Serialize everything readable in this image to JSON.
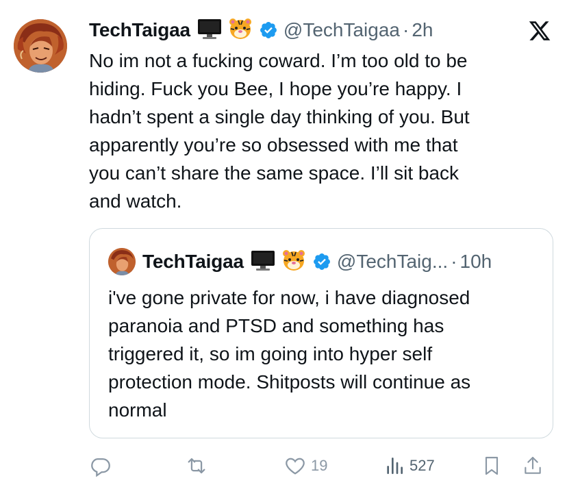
{
  "tweet": {
    "author": {
      "name": "TechTaigaa",
      "emojis": [
        "computer-icon",
        "tiger-face-icon"
      ],
      "verified": true,
      "handle": "@TechTaigaa",
      "separator": "·",
      "time": "2h"
    },
    "text": "No im not a fucking coward. I’m too old to be\nhiding. Fuck you Bee, I hope you’re happy. I\nhadn’t spent a single day thinking of you. But\napparently you’re so obsessed with me that\nyou can’t share the same space. I’ll sit back\nand watch.",
    "quote": {
      "author": {
        "name": "TechTaigaa",
        "handle": "@TechTaig...",
        "separator": "·",
        "time": "10h"
      },
      "text": "i've gone private for now, i have diagnosed\nparanoia and PTSD and something has\ntriggered it, so im going into hyper self\nprotection mode. Shitposts will continue as\nnormal"
    },
    "actions": {
      "reply_icon": "reply-icon",
      "retweet_icon": "retweet-icon",
      "like_icon": "heart-icon",
      "like_count": "19",
      "views_icon": "views-icon",
      "views_count": "527",
      "bookmark_icon": "bookmark-icon",
      "share_icon": "share-icon"
    }
  },
  "colors": {
    "text": "#0f1419",
    "secondary": "#536471",
    "muted": "#8b98a5",
    "verified": "#1d9bf0",
    "border": "#cfd9de"
  }
}
